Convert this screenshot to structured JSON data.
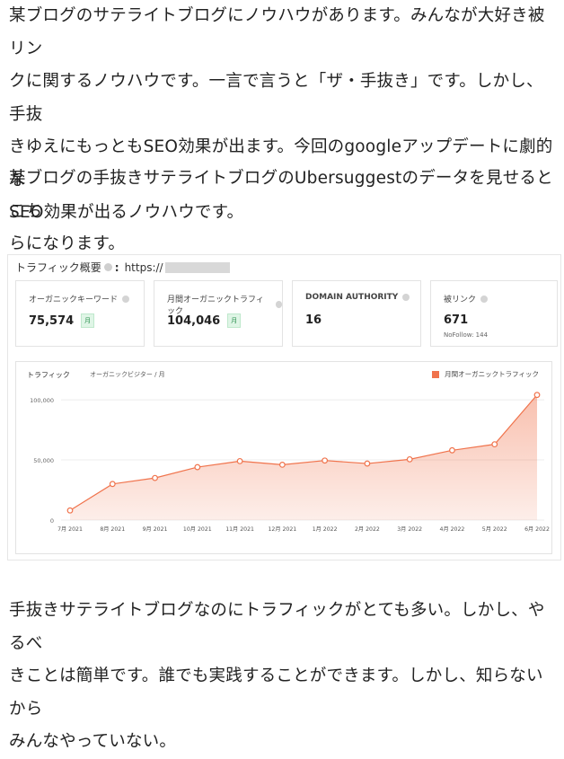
{
  "paragraphs": [
    "某ブログのサテライトブログにノウハウがあります。みんなが大好き被リンクに関するノウハウです。一言で言うと「ザ・手抜き」です。しかし、手抜きゆえにもっともSEO効果が出ます。今回のgoogleアップデートに劇的なSEO効果が出るノウハウです。",
    "某ブログの手抜きサテライトブログのUbersuggestのデータを見せるとこちらになります。",
    "手抜きサテライトブログなのにトラフィックがとても多い。しかし、やるべきことは簡単です。誰でも実践することができます。しかし、知らないからみんなやっていない。"
  ],
  "paragraph_lines": [
    [
      "某ブログのサテライトブログにノウハウがあります。みんなが大好き被リン",
      "クに関するノウハウです。一言で言うと「ザ・手抜き」です。しかし、手抜",
      "きゆえにもっともSEO効果が出ます。今回のgoogleアップデートに劇的な",
      "SEO効果が出るノウハウです。"
    ],
    [
      "某ブログの手抜きサテライトブログのUbersuggestのデータを見せるとこち",
      "らになります。"
    ],
    [
      "手抜きサテライトブログなのにトラフィックがとても多い。しかし、やるべ",
      "きことは簡単です。誰でも実践することができます。しかし、知らないから",
      "みんなやっていない。"
    ]
  ],
  "screenshot": {
    "header_title": "トラフィック概要",
    "header_url": "https://",
    "metrics": [
      {
        "label": "オーガニックキーワード",
        "value": "75,574",
        "badge": "月"
      },
      {
        "label": "月間オーガニックトラフィック",
        "value": "104,046",
        "badge": "月"
      },
      {
        "label": "DOMAIN AUTHORITY",
        "value": "16",
        "badge": ""
      },
      {
        "label": "被リンク",
        "value": "671",
        "sub": "NoFollow: 144"
      }
    ],
    "chart_title": "トラフィック",
    "chart_subtitle": "オーガニックビジター / 月",
    "legend_label": "月間オーガニックトラフィック",
    "accent_color": "#f0734c"
  },
  "chart_data": {
    "type": "area",
    "x": [
      "7月 2021",
      "8月 2021",
      "9月 2021",
      "10月 2021",
      "11月 2021",
      "12月 2021",
      "1月 2022",
      "2月 2022",
      "3月 2022",
      "4月 2022",
      "5月 2022",
      "6月 2022"
    ],
    "series": [
      {
        "name": "月間オーガニックトラフィック",
        "values": [
          8000,
          30000,
          35000,
          44000,
          49000,
          46000,
          49500,
          47000,
          50500,
          58000,
          63000,
          104046
        ]
      }
    ],
    "yticks": [
      "0",
      "50,000",
      "100,000"
    ],
    "ylim": [
      0,
      115000
    ],
    "grid": true,
    "legend": "top-right",
    "title": "トラフィック",
    "ylabel": "オーガニックビジター / 月"
  }
}
